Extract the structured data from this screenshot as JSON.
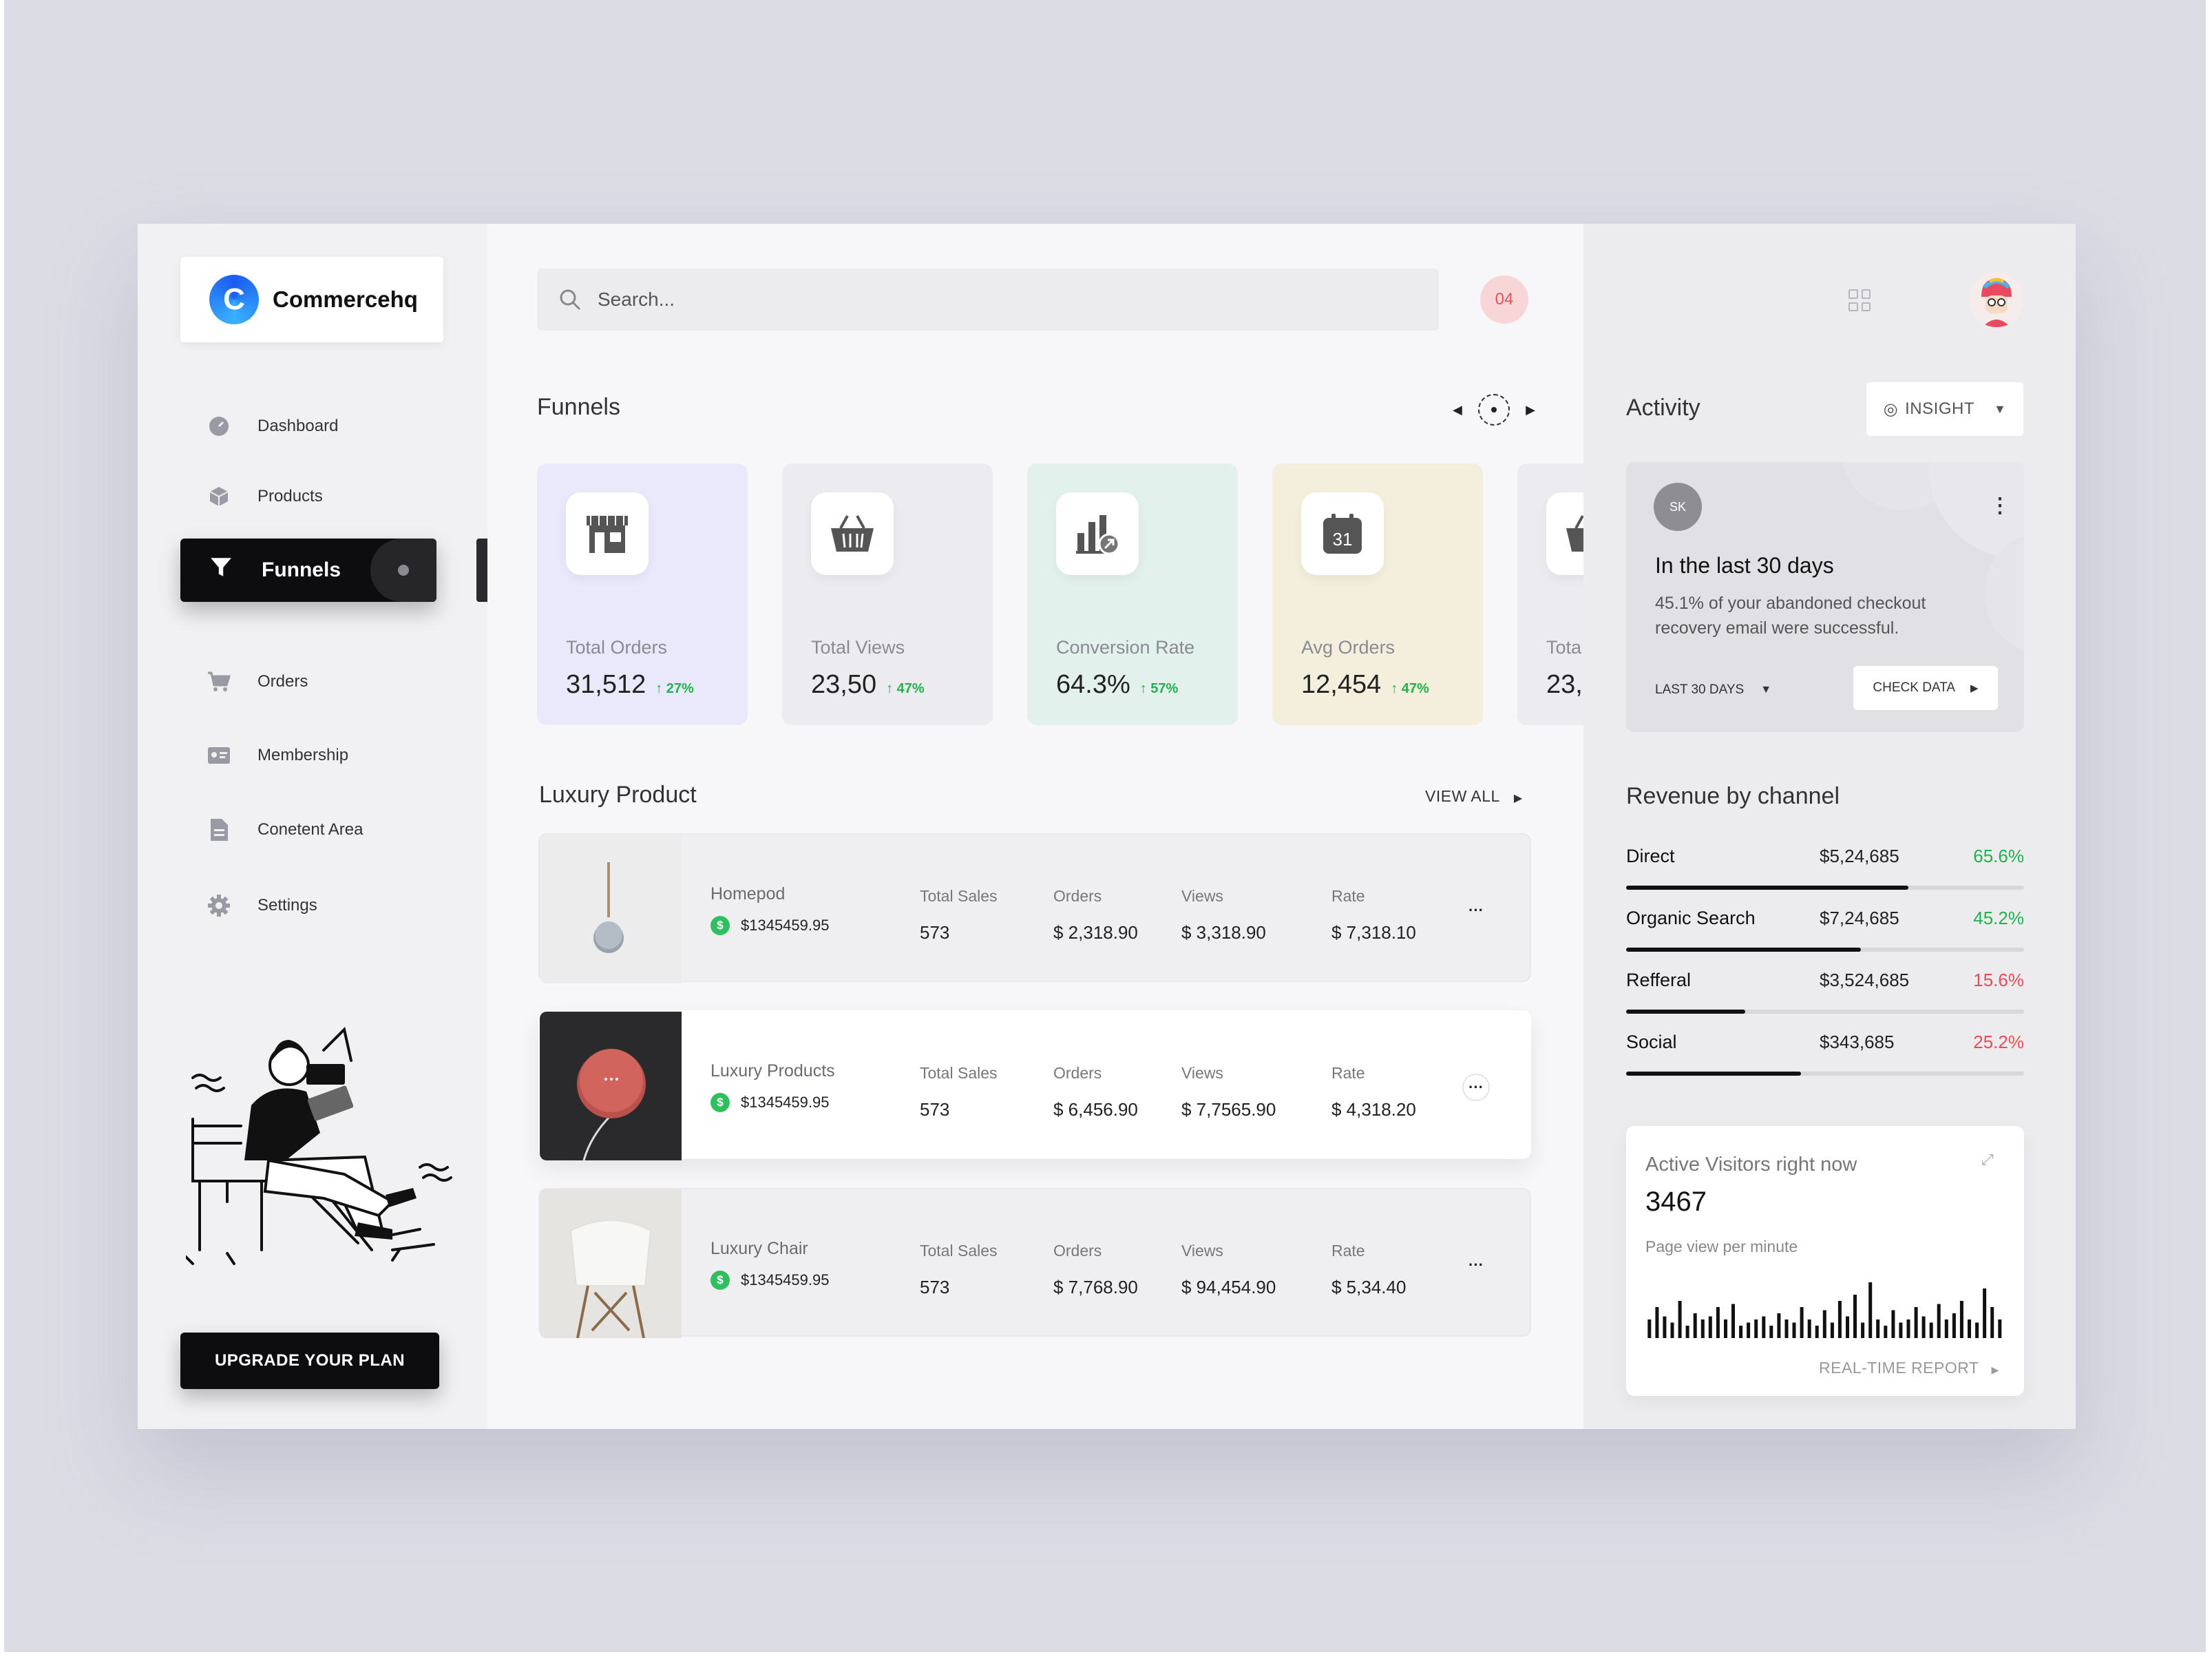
{
  "brand": {
    "name": "Commercehq",
    "logo_letter": "C"
  },
  "sidebar": {
    "items": [
      {
        "label": "Dashboard",
        "icon": "dashboard-icon"
      },
      {
        "label": "Products",
        "icon": "box-icon"
      },
      {
        "label": "Funnels",
        "icon": "funnel-icon",
        "active": true
      },
      {
        "label": "Orders",
        "icon": "cart-icon"
      },
      {
        "label": "Membership",
        "icon": "id-card-icon"
      },
      {
        "label": "Conetent Area",
        "icon": "document-icon"
      },
      {
        "label": "Settings",
        "icon": "gear-icon"
      }
    ],
    "upgrade_label": "UPGRADE YOUR PLAN"
  },
  "search": {
    "placeholder": "Search..."
  },
  "notifications": {
    "count": "04"
  },
  "funnels": {
    "title": "Funnels",
    "cards": [
      {
        "label": "Total Orders",
        "value": "31,512",
        "change": "↑ 27%",
        "bg": "#e9e9fb",
        "icon": "store-icon"
      },
      {
        "label": "Total Views",
        "value": "23,50",
        "change": "↑ 47%",
        "bg": "#ececf0",
        "icon": "basket-icon"
      },
      {
        "label": "Conversion Rate",
        "value": "64.3%",
        "change": "↑ 57%",
        "bg": "#e3f1ed",
        "icon": "bar-chart-icon"
      },
      {
        "label": "Avg Orders",
        "value": "12,454",
        "change": "↑ 47%",
        "bg": "#f3efdc",
        "icon": "calendar-icon"
      },
      {
        "label": "Tota",
        "value": "23,",
        "change": "",
        "bg": "#ececf0",
        "icon": "basket-icon"
      }
    ]
  },
  "products": {
    "title": "Luxury Product",
    "view_all": "VIEW ALL",
    "rows": [
      {
        "name": "Homepod",
        "price": "$1345459.95",
        "total_sales_label": "Total Sales",
        "total_sales": "573",
        "orders_label": "Orders",
        "orders": "$ 2,318.90",
        "views_label": "Views",
        "views": "$ 3,318.90",
        "rate_label": "Rate",
        "rate": "$ 7,318.10"
      },
      {
        "name": "Luxury Products",
        "price": "$1345459.95",
        "total_sales_label": "Total Sales",
        "total_sales": "573",
        "orders_label": "Orders",
        "orders": "$ 6,456.90",
        "views_label": "Views",
        "views": "$ 7,7565.90",
        "rate_label": "Rate",
        "rate": "$ 4,318.20"
      },
      {
        "name": "Luxury Chair",
        "price": "$1345459.95",
        "total_sales_label": "Total Sales",
        "total_sales": "573",
        "orders_label": "Orders",
        "orders": "$ 7,768.90",
        "views_label": "Views",
        "views": "$ 94,454.90",
        "rate_label": "Rate",
        "rate": "$ 5,34.40"
      }
    ]
  },
  "activity": {
    "title": "Activity",
    "insight_label": "INSIGHT",
    "card": {
      "initials": "SK",
      "title": "In the last 30 days",
      "description": "45.1% of your abandoned checkout recovery email were successful.",
      "period": "LAST 30 DAYS",
      "check_label": "CHECK DATA"
    }
  },
  "revenue": {
    "title": "Revenue by channel",
    "channels": [
      {
        "name": "Direct",
        "amount": "$5,24,685",
        "percent": "65.6%",
        "fill": 0.71,
        "color": "#22b14c"
      },
      {
        "name": "Organic Search",
        "amount": "$7,24,685",
        "percent": "45.2%",
        "fill": 0.59,
        "color": "#22b14c"
      },
      {
        "name": "Refferal",
        "amount": "$3,524,685",
        "percent": "15.6%",
        "fill": 0.3,
        "color": "#ec4b55"
      },
      {
        "name": "Social",
        "amount": "$343,685",
        "percent": "25.2%",
        "fill": 0.44,
        "color": "#ec4b55"
      }
    ]
  },
  "visitors": {
    "title": "Active Visitors right now",
    "count": "3467",
    "subtitle": "Page view per minute",
    "report_label": "REAL-TIME REPORT",
    "bars": [
      0.3,
      0.5,
      0.35,
      0.25,
      0.6,
      0.2,
      0.4,
      0.3,
      0.35,
      0.5,
      0.3,
      0.55,
      0.2,
      0.25,
      0.3,
      0.35,
      0.2,
      0.4,
      0.3,
      0.25,
      0.5,
      0.3,
      0.2,
      0.45,
      0.25,
      0.6,
      0.35,
      0.7,
      0.25,
      0.9,
      0.3,
      0.2,
      0.45,
      0.25,
      0.3,
      0.5,
      0.35,
      0.25,
      0.55,
      0.3,
      0.4,
      0.6,
      0.3,
      0.25,
      0.8,
      0.5,
      0.3
    ]
  }
}
